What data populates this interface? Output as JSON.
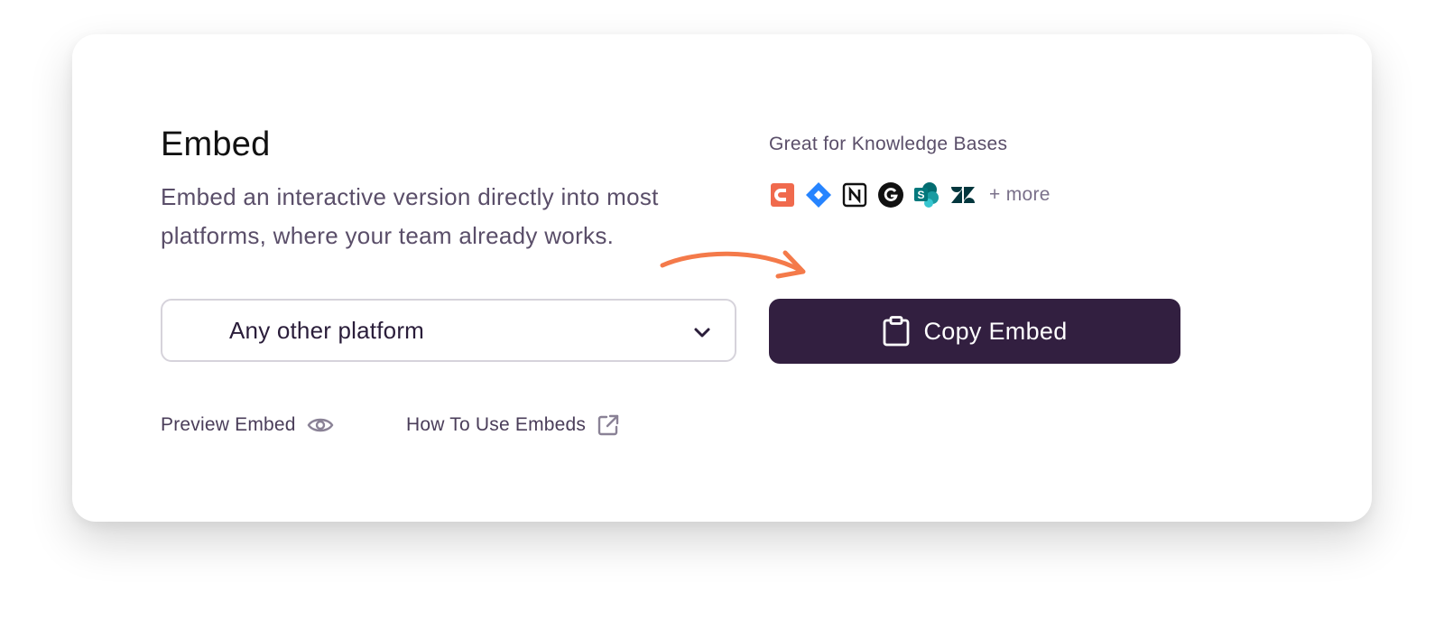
{
  "card": {
    "title": "Embed",
    "description": "Embed an interactive version directly into most platforms, where your team already works."
  },
  "knowledge_bases": {
    "label": "Great for Knowledge Bases",
    "logos": [
      "confluence-icon",
      "jira-icon",
      "notion-icon",
      "guru-icon",
      "sharepoint-icon",
      "zendesk-icon"
    ],
    "more_label": "+ more"
  },
  "platform_select": {
    "value": "Any other platform",
    "icon": "chevron-down-icon"
  },
  "copy_button": {
    "label": "Copy Embed",
    "icon": "clipboard-icon",
    "color": "#321f40"
  },
  "links": {
    "preview_label": "Preview Embed",
    "preview_icon": "eye-icon",
    "howto_label": "How To Use Embeds",
    "howto_icon": "external-link-icon"
  },
  "colors": {
    "accent_arrow": "#f47a4a",
    "text_primary": "#111111",
    "text_secondary": "#5a4e69"
  }
}
